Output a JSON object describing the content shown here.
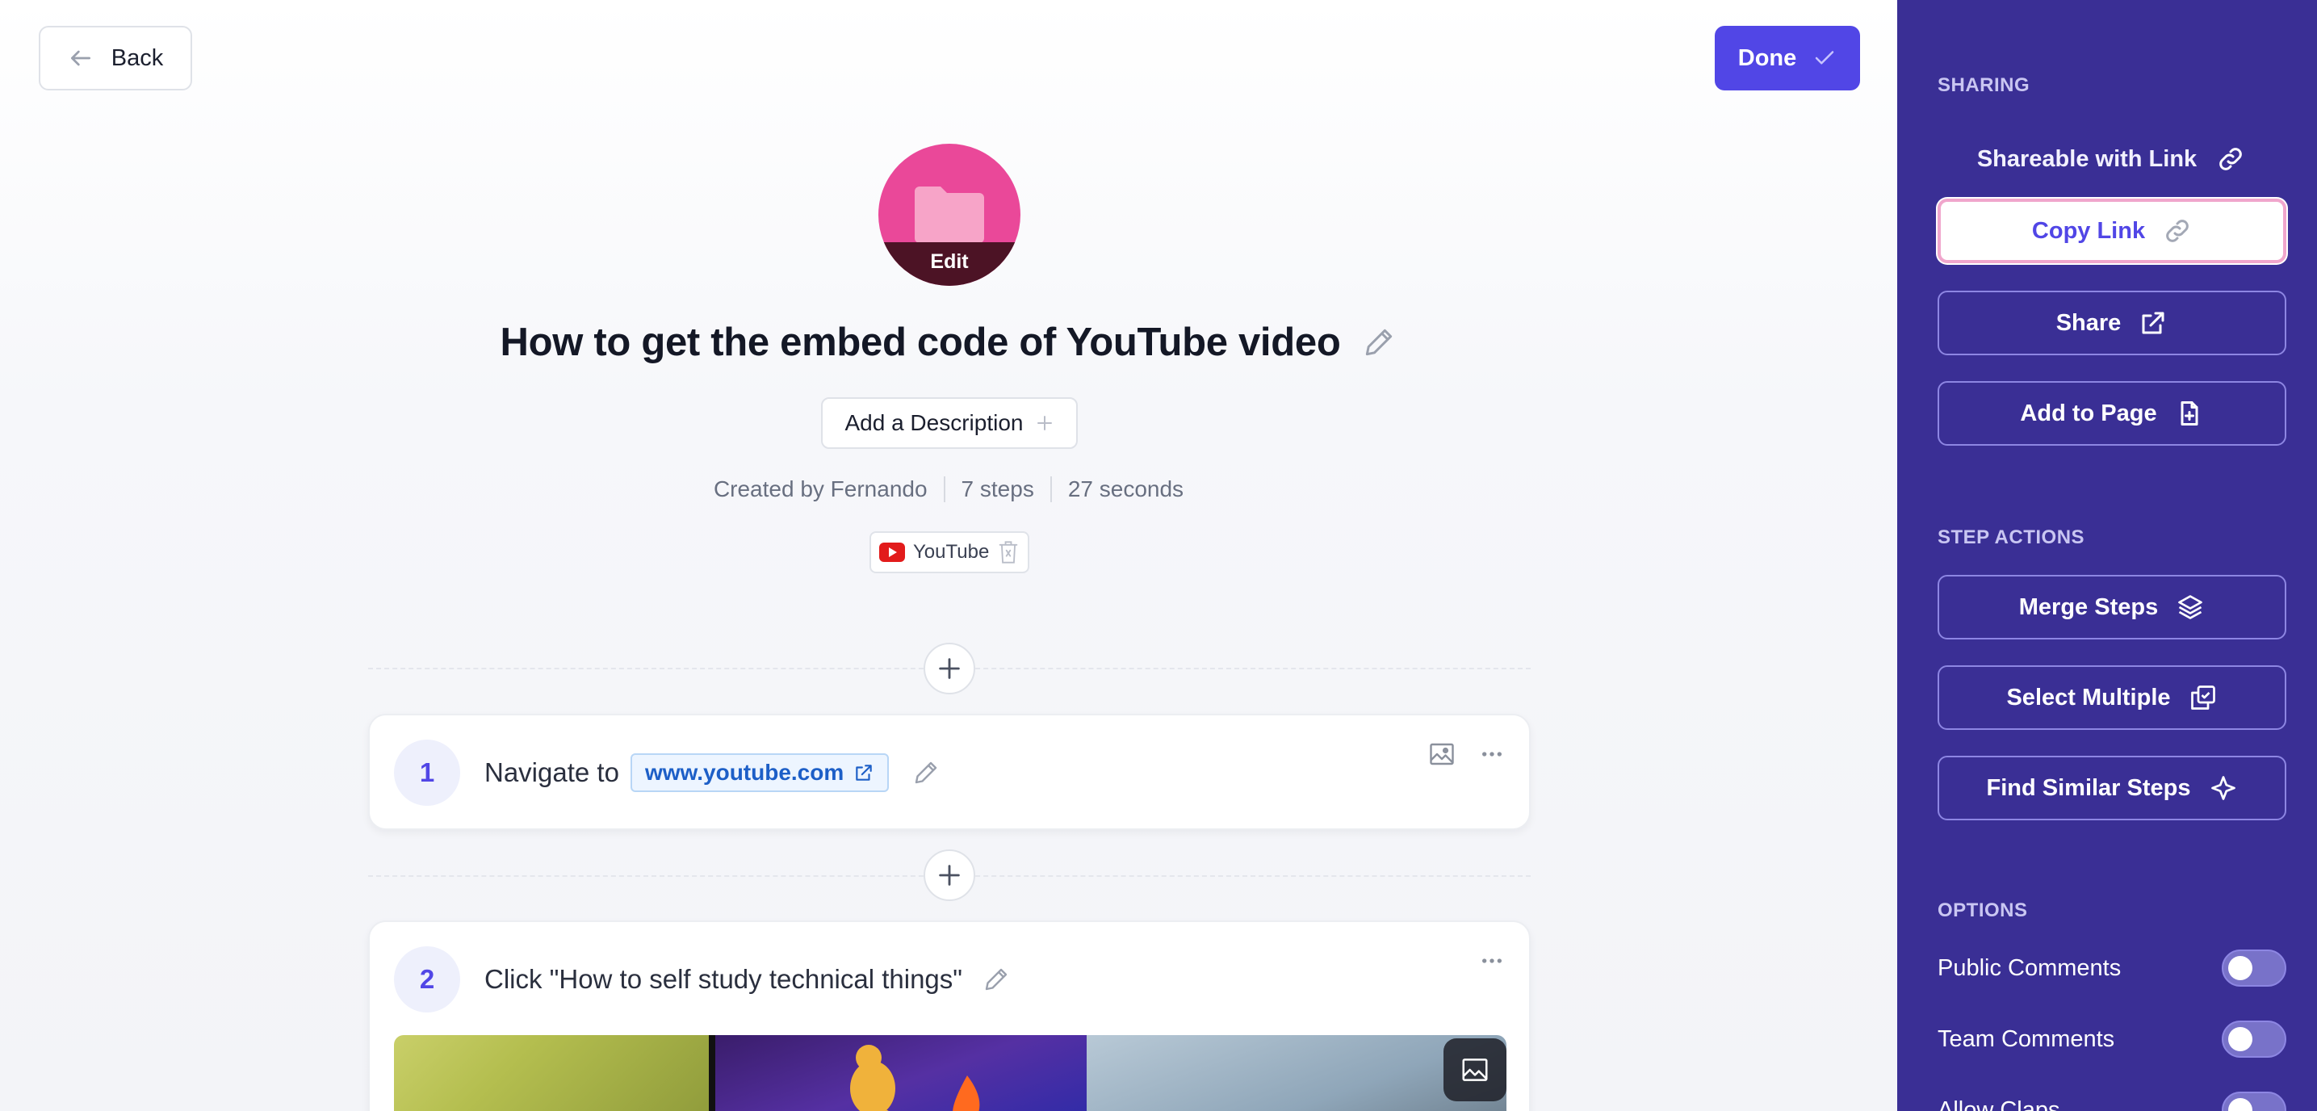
{
  "header": {
    "back_label": "Back",
    "done_label": "Done"
  },
  "guide": {
    "avatar_edit_label": "Edit",
    "title": "How to get the embed code of YouTube video",
    "add_description_label": "Add a Description",
    "meta": {
      "created_by": "Created by Fernando",
      "steps": "7 steps",
      "duration": "27 seconds"
    },
    "tag": "YouTube"
  },
  "steps": [
    {
      "number": "1",
      "prefix": "Navigate to",
      "link": "www.youtube.com"
    },
    {
      "number": "2",
      "text": "Click \"How to self study technical things\""
    }
  ],
  "sidebar": {
    "sharing_heading": "SHARING",
    "share_status": "Shareable with Link",
    "copy_link": "Copy Link",
    "share": "Share",
    "add_to_page": "Add to Page",
    "step_actions_heading": "STEP ACTIONS",
    "merge_steps": "Merge Steps",
    "select_multiple": "Select Multiple",
    "find_similar_steps": "Find Similar Steps",
    "options_heading": "OPTIONS",
    "options": [
      {
        "label": "Public Comments",
        "enabled": false
      },
      {
        "label": "Team Comments",
        "enabled": false
      },
      {
        "label": "Allow Claps",
        "enabled": false
      }
    ]
  },
  "colors": {
    "accent": "#5146e6",
    "sidebar_bg": "#3a2f95",
    "avatar": "#ea4899",
    "link": "#1d5fc7"
  }
}
